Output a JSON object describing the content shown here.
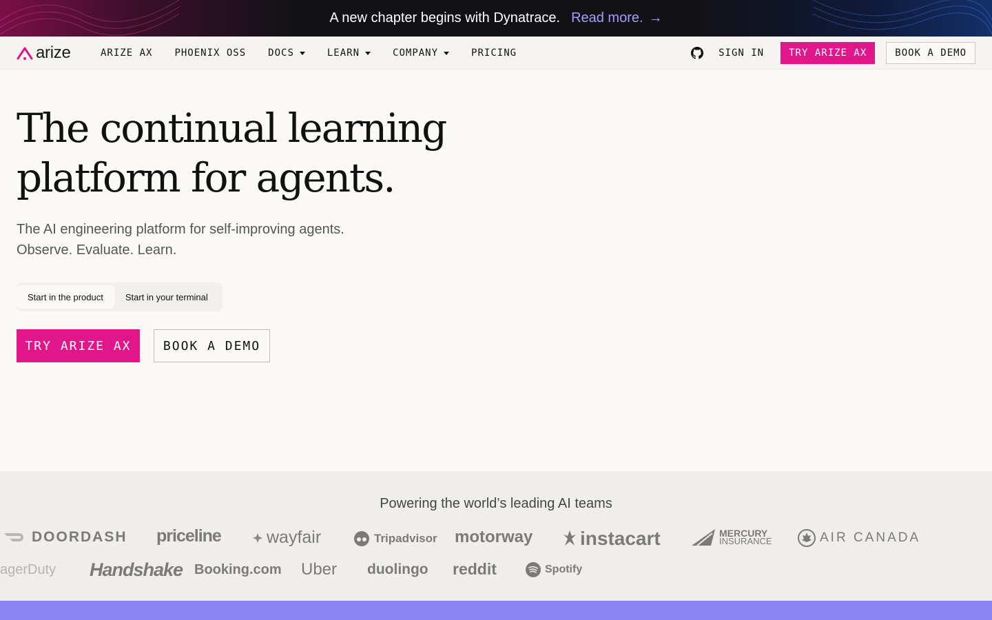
{
  "announcement": {
    "text": "A new chapter begins with Dynatrace.",
    "link_label": "Read more.",
    "link_arrow": "→"
  },
  "nav": {
    "logo_text": "arize",
    "links": [
      {
        "label": "ARIZE AX"
      },
      {
        "label": "PHOENIX OSS"
      },
      {
        "label": "DOCS"
      },
      {
        "label": "LEARN"
      },
      {
        "label": "COMPANY"
      },
      {
        "label": "PRICING"
      }
    ],
    "sign_in": "SIGN IN",
    "try_label": "TRY ARIZE AX",
    "demo_label": "BOOK A DEMO"
  },
  "hero": {
    "title_line1": "The continual learning",
    "title_line2": "platform for agents.",
    "subtitle_line1": "The AI engineering platform for self-improving agents.",
    "subtitle_line2": "Observe. Evaluate. Learn.",
    "tabs": [
      {
        "label": "Start in the product",
        "active": true
      },
      {
        "label": "Start in your terminal",
        "active": false
      }
    ],
    "try_label": "TRY ARIZE AX",
    "demo_label": "BOOK A DEMO"
  },
  "logos": {
    "title": "Powering the world’s leading AI teams",
    "row1": [
      "DOORDASH",
      "priceline",
      "wayfair",
      "Tripadvisor",
      "motorway",
      "instacart",
      "MERCURY",
      "INSURANCE",
      "AIR CANADA"
    ],
    "row2": [
      "agerDuty",
      "Handshake",
      "Booking.com",
      "Uber",
      "duolingo",
      "reddit",
      "Spotify"
    ]
  },
  "colors": {
    "accent": "#e0168a",
    "link": "#a79cff",
    "footer_band": "#8b85f5"
  }
}
